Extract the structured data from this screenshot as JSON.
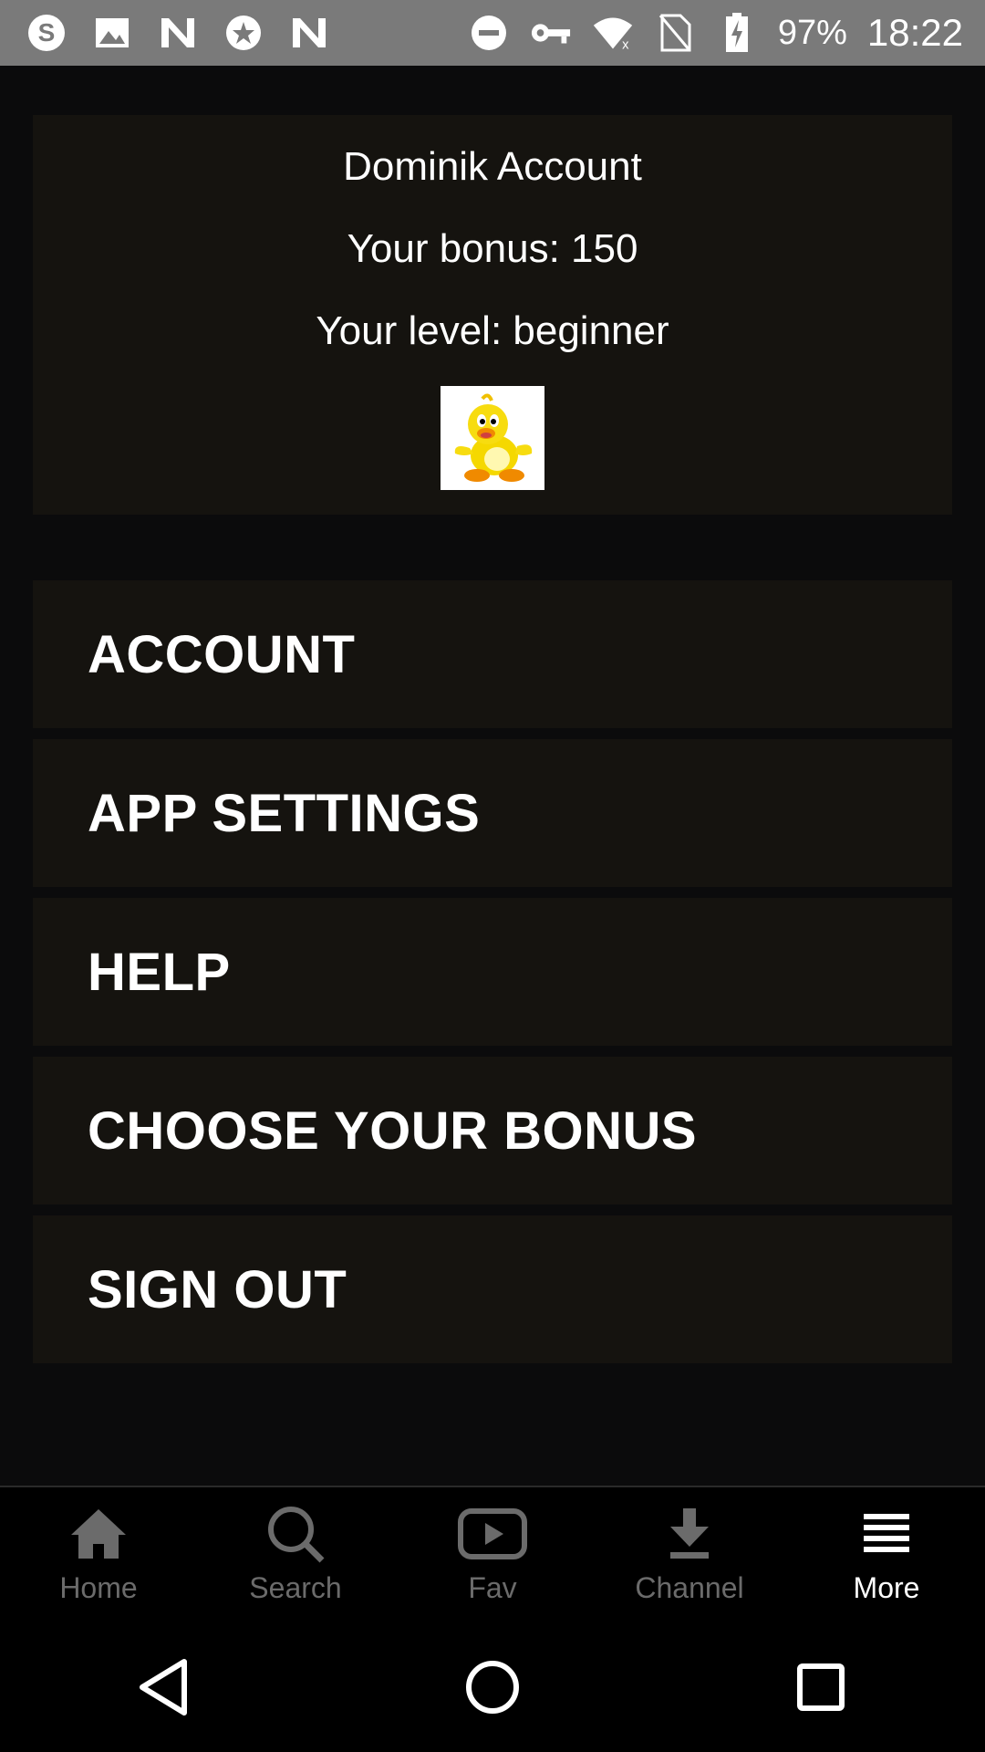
{
  "status_bar": {
    "left_icons": [
      "skype-icon",
      "image-icon",
      "n-app-icon",
      "star-badge-icon",
      "n-app-icon"
    ],
    "right_icons": [
      "do-not-disturb-icon",
      "vpn-key-icon",
      "wifi-off-icon",
      "no-sim-icon",
      "battery-charging-icon"
    ],
    "battery": "97%",
    "time": "18:22"
  },
  "account": {
    "name": "Dominik Account",
    "bonus": "Your bonus: 150",
    "level": "Your level: beginner",
    "avatar": "duck-avatar"
  },
  "menu": {
    "items": [
      {
        "label": "ACCOUNT"
      },
      {
        "label": "APP SETTINGS"
      },
      {
        "label": "HELP"
      },
      {
        "label": "CHOOSE YOUR BONUS"
      },
      {
        "label": "SIGN OUT"
      }
    ]
  },
  "bottom_nav": {
    "items": [
      {
        "label": "Home",
        "icon": "home-icon"
      },
      {
        "label": "Search",
        "icon": "search-icon"
      },
      {
        "label": "Fav",
        "icon": "play-icon"
      },
      {
        "label": "Channel",
        "icon": "download-icon"
      },
      {
        "label": "More",
        "icon": "menu-icon",
        "active": true
      }
    ]
  },
  "colors": {
    "background": "#0b0b0c",
    "card": "#15130f",
    "status_bar": "#7a7a7a",
    "nav_inactive": "#6b6b6b",
    "nav_active": "#ffffff"
  }
}
